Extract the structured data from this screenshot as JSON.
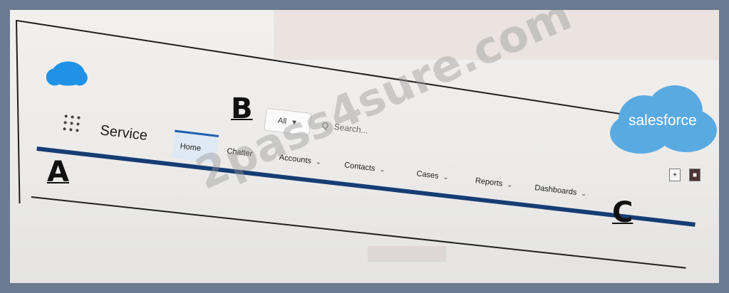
{
  "app": {
    "name": "Service"
  },
  "search": {
    "scope": "All",
    "placeholder": "Search..."
  },
  "tabs": [
    {
      "label": "Home",
      "active": true,
      "dropdown": false
    },
    {
      "label": "Chatter",
      "dropdown": false
    },
    {
      "label": "Accounts",
      "dropdown": true
    },
    {
      "label": "Contacts",
      "dropdown": true
    },
    {
      "label": "Cases",
      "dropdown": true
    },
    {
      "label": "Reports",
      "dropdown": true
    },
    {
      "label": "Dashboards",
      "dropdown": true
    }
  ],
  "callouts": {
    "a": "A",
    "b": "B",
    "c": "C"
  },
  "logo": {
    "text": "salesforce",
    "color": "#5aaae2"
  },
  "watermark": "2pass4sure.com",
  "colors": {
    "nav_bar": "#173c74",
    "cloud": "#1f92e6"
  },
  "icons": {
    "launcher": "app-launcher-grid-icon",
    "search": "search-icon",
    "dropdown": "chevron-down-icon"
  }
}
